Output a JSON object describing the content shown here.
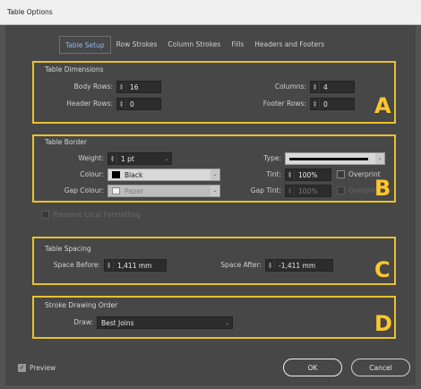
{
  "window": {
    "title": "Table Options"
  },
  "tabs": [
    {
      "label": "Table Setup",
      "active": true
    },
    {
      "label": "Row Strokes"
    },
    {
      "label": "Column Strokes"
    },
    {
      "label": "Fills"
    },
    {
      "label": "Headers and Footers"
    }
  ],
  "dimensions": {
    "title": "Table Dimensions",
    "letter": "A",
    "body_rows_label": "Body Rows:",
    "body_rows": "16",
    "columns_label": "Columns:",
    "columns": "4",
    "header_rows_label": "Header Rows:",
    "header_rows": "0",
    "footer_rows_label": "Footer Rows:",
    "footer_rows": "0"
  },
  "border": {
    "title": "Table Border",
    "letter": "B",
    "weight_label": "Weight:",
    "weight": "1 pt",
    "type_label": "Type:",
    "colour_label": "Colour:",
    "colour": "Black",
    "tint_label": "Tint:",
    "tint": "100%",
    "overprint_label": "Overprint",
    "gap_colour_label": "Gap Colour:",
    "gap_colour": "Paper",
    "gap_tint_label": "Gap Tint:",
    "gap_tint": "100%",
    "gap_overprint_label": "Overprint"
  },
  "preserve_local": {
    "label": "Preserve Local Formatting"
  },
  "spacing": {
    "title": "Table Spacing",
    "letter": "C",
    "space_before_label": "Space Before:",
    "space_before": "1,411 mm",
    "space_after_label": "Space After:",
    "space_after": "-1,411 mm"
  },
  "drawing": {
    "title": "Stroke Drawing Order",
    "letter": "D",
    "draw_label": "Draw:",
    "draw": "Best Joins"
  },
  "footer": {
    "preview_label": "Preview",
    "preview_checked": true,
    "ok_label": "OK",
    "cancel_label": "Cancel"
  },
  "colors": {
    "highlight": "#e8c22d",
    "dialog_bg": "#474747",
    "active_tab_text": "#8fb8f0"
  }
}
